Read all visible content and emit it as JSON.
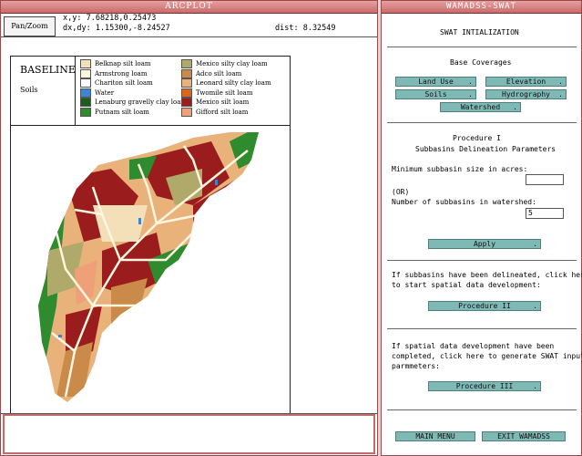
{
  "arcplot": {
    "title": "ARCPLOT",
    "pan_zoom_label": "Pan/Zoom",
    "xy_line": "x,y: 7.68218,0.25473",
    "dxdy_line": "dx,dy: 1.15300,-8.24527",
    "dist_line": "dist: 8.32549",
    "legend": {
      "title": "BASELINE",
      "subtitle": "Soils",
      "items": [
        {
          "label": "Belknap silt loam",
          "color": "#f3dfb8"
        },
        {
          "label": "Armstrong loam",
          "color": "#fff6e0"
        },
        {
          "label": "Chariton silt loam",
          "color": "#ffffff"
        },
        {
          "label": "Water",
          "color": "#3d84d6"
        },
        {
          "label": "Lenaburg gravelly clay loam",
          "color": "#1f5a1f"
        },
        {
          "label": "Putnam silt loam",
          "color": "#2e8b2e"
        },
        {
          "label": "Mexico silty clay loam",
          "color": "#b0aa6a"
        },
        {
          "label": "Adco silt loam",
          "color": "#c98a4a"
        },
        {
          "label": "Leonard silty clay loam",
          "color": "#e8b27a"
        },
        {
          "label": "Twomile silt loam",
          "color": "#d9661c"
        },
        {
          "label": "Mexico silt loam",
          "color": "#9b1c1c"
        },
        {
          "label": "Gifford silt loam",
          "color": "#f0a078"
        }
      ]
    }
  },
  "wamadss": {
    "title": "WAMADSS-SWAT",
    "heading": "SWAT INTIALIZATION",
    "base_coverages_label": "Base Coverages",
    "buttons": {
      "land_use": "Land Use",
      "elevation": "Elevation",
      "soils": "Soils",
      "hydrography": "Hydrography",
      "watershed": "Watershed",
      "apply": "Apply",
      "procedure2": "Procedure II",
      "procedure3": "Procedure  III",
      "main_menu": "MAIN MENU",
      "exit": "EXIT WAMADSS"
    },
    "procedure1_title": "Procedure I",
    "procedure1_subtitle": "Subbasins Delineation Parameters",
    "min_size_label": "Minimum subbasin size in acres:",
    "min_size_value": "",
    "or_label": "(OR)",
    "num_subbasins_label": "Number of subbasins in watershed:",
    "num_subbasins_value": "5",
    "p2_text_1": "If subbasins have been delineated, click here",
    "p2_text_2": "to start spatial data development:",
    "p3_text_1": "If spatial data development have been",
    "p3_text_2": "completed, click here to generate SWAT input",
    "p3_text_3": "parmmeters:"
  }
}
